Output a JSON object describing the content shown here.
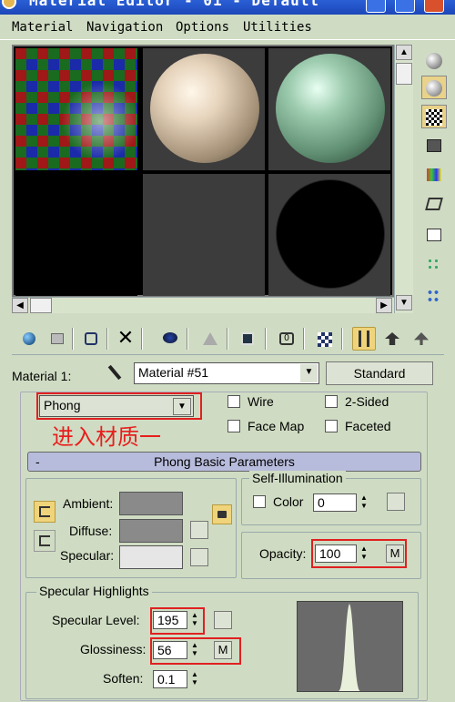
{
  "window": {
    "title": "Material Editor - 01 - Default"
  },
  "menu": {
    "items": [
      "Material",
      "Navigation",
      "Options",
      "Utilities"
    ]
  },
  "colors": {
    "accent_red": "#e02020",
    "selected_tool": "#efd47b",
    "panel_bg": "#cfdcc3",
    "rollout_bg": "#b8bcdc"
  },
  "sidebar_icons": [
    "sample-type-icon",
    "backlight-icon",
    "background-checker-icon",
    "sample-uv-icon",
    "video-color-check-icon",
    "make-preview-icon",
    "options-icon",
    "select-by-material-icon",
    "material-map-navigator-icon"
  ],
  "toolbar_icons": [
    "get-material-icon",
    "put-to-scene-icon",
    "assign-to-selection-icon",
    "reset-map-icon",
    "make-unique-icon",
    "put-to-library-icon",
    "material-effects-channel-icon",
    "show-map-in-viewport-icon",
    "show-end-result-icon",
    "go-to-parent-icon",
    "go-forward-sibling-icon"
  ],
  "material": {
    "label": "Material 1:",
    "name": "Material #51",
    "type_button": "Standard"
  },
  "shader": {
    "selected": "Phong",
    "wire": "Wire",
    "two_sided": "2-Sided",
    "face_map": "Face Map",
    "faceted": "Faceted"
  },
  "annotation": "进入材质一",
  "rollout": {
    "collapse": "-",
    "title": "Phong Basic Parameters"
  },
  "basic": {
    "ambient": "Ambient:",
    "diffuse": "Diffuse:",
    "specular": "Specular:"
  },
  "self_illum": {
    "title": "Self-Illumination",
    "color_label": "Color",
    "value": "0"
  },
  "opacity": {
    "label": "Opacity:",
    "value": "100",
    "map_button": "M"
  },
  "highlights": {
    "title": "Specular Highlights",
    "level_label": "Specular Level:",
    "level_value": "195",
    "gloss_label": "Glossiness:",
    "gloss_value": "56",
    "gloss_map": "M",
    "soften_label": "Soften:",
    "soften_value": "0.1"
  }
}
